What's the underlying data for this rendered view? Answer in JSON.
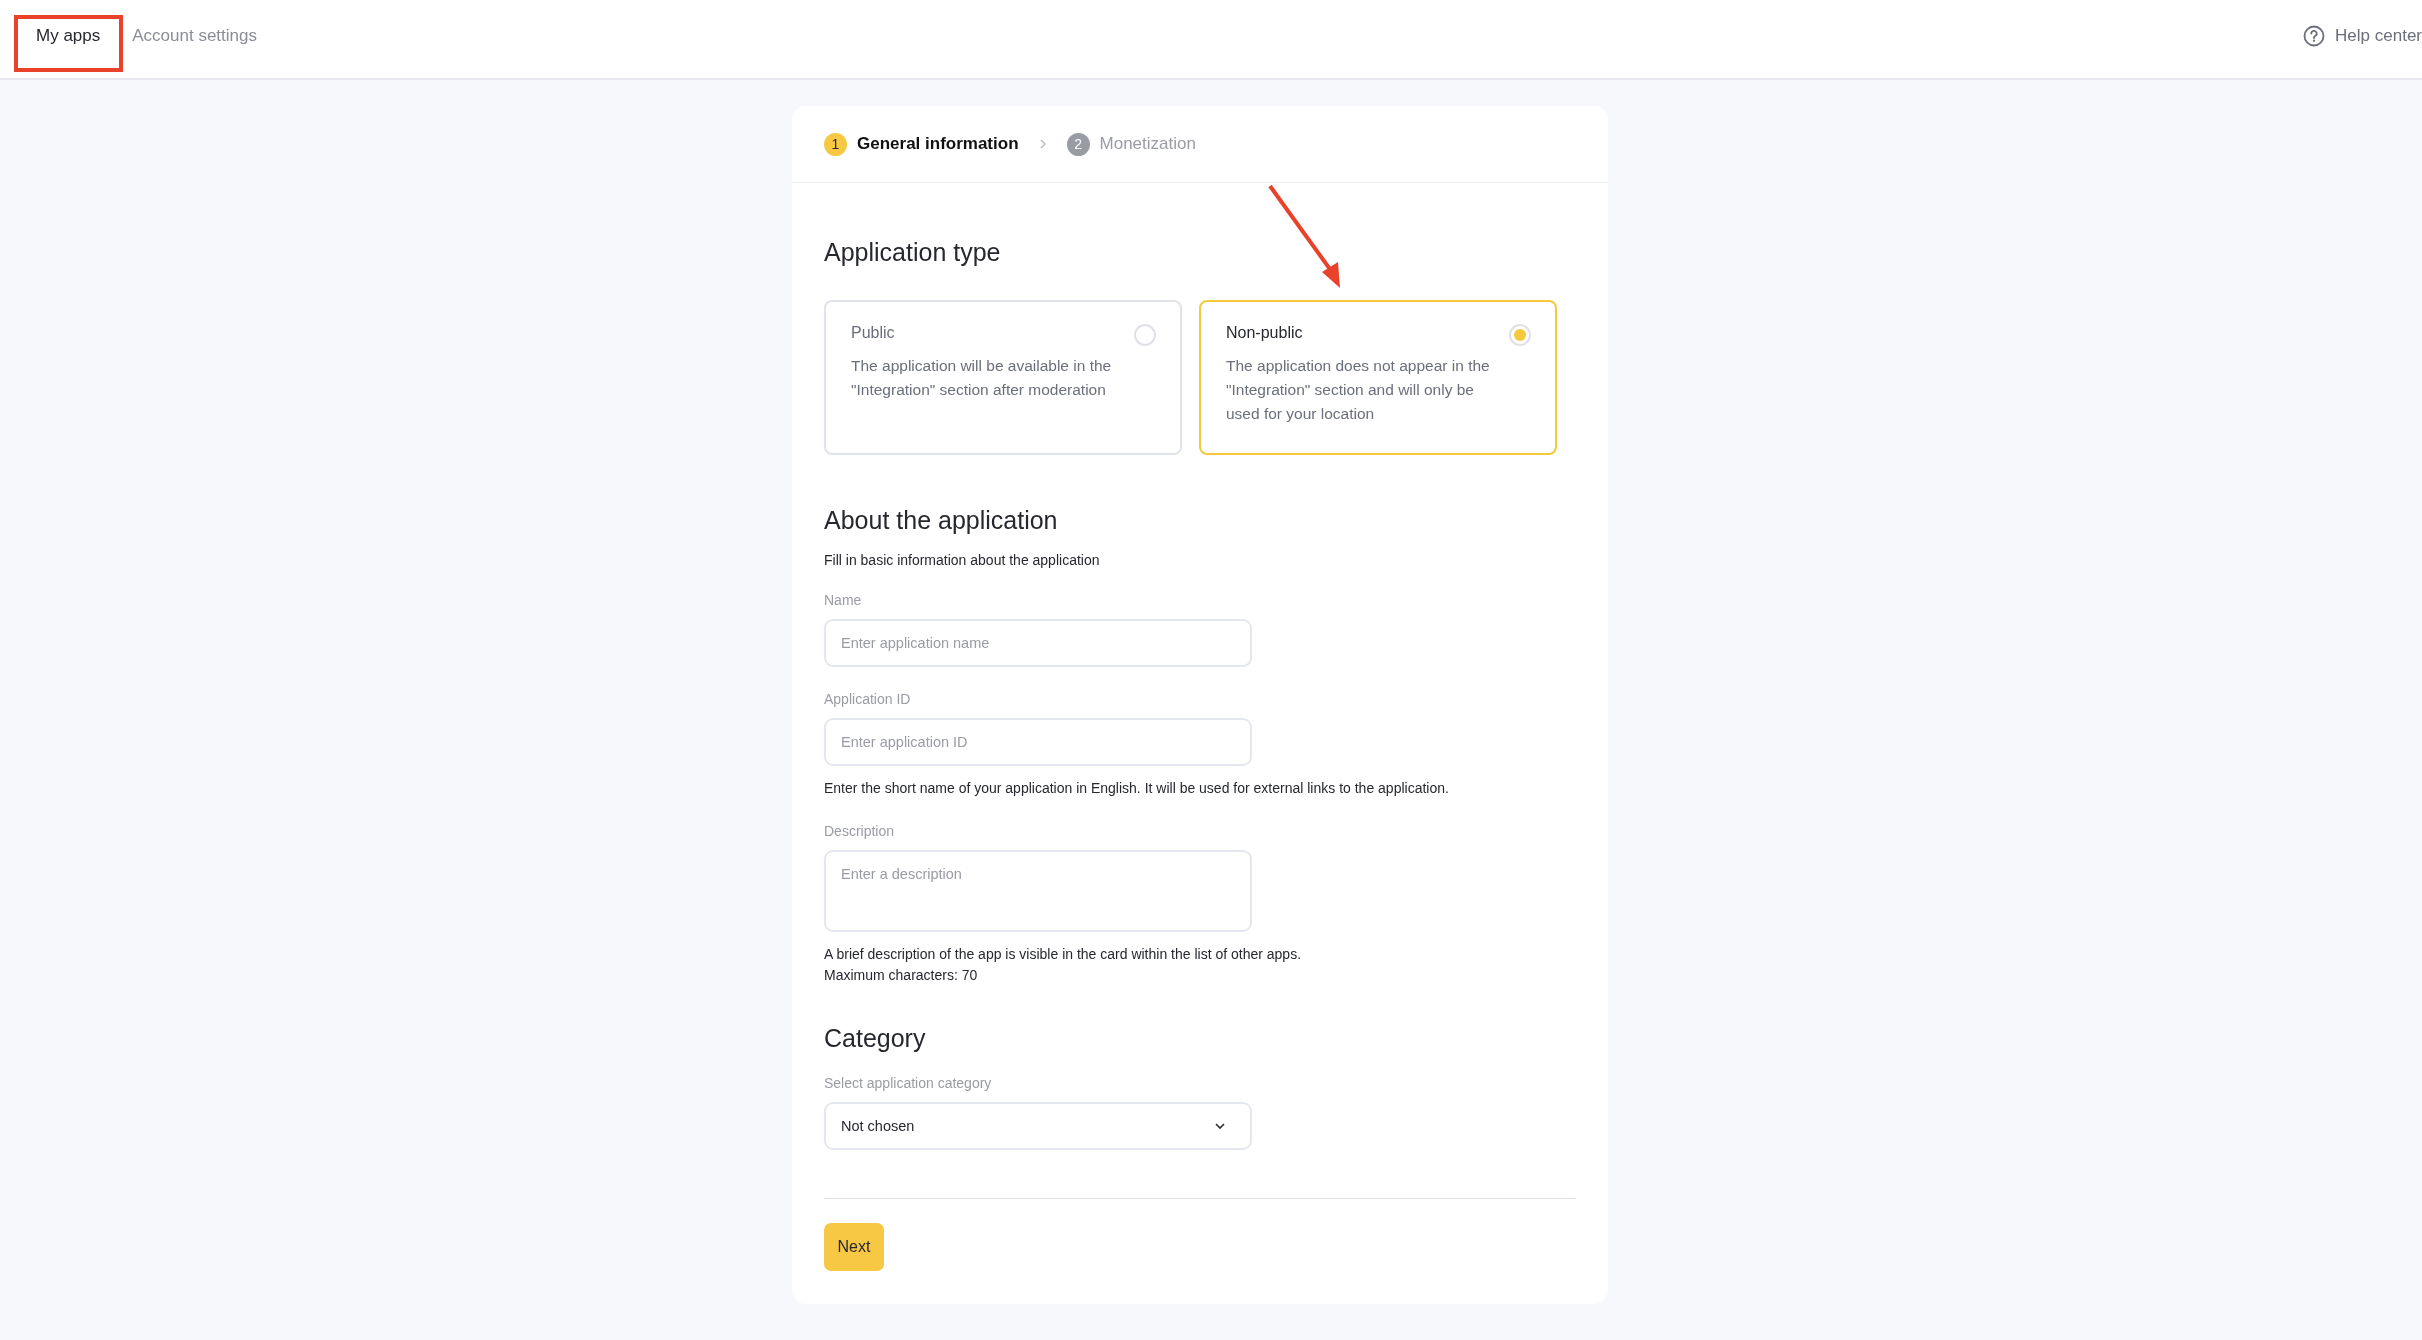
{
  "nav": {
    "tabs": [
      {
        "label": "My apps",
        "selected": true
      },
      {
        "label": "Account settings",
        "selected": false
      }
    ],
    "help": "Help center"
  },
  "stepper": [
    {
      "number": "1",
      "label": "General information",
      "active": true
    },
    {
      "number": "2",
      "label": "Monetization",
      "active": false
    }
  ],
  "application_type": {
    "title": "Application type",
    "options": [
      {
        "title": "Public",
        "description": "The application will be available in the \"Integration\" section after moderation",
        "selected": false
      },
      {
        "title": "Non-public",
        "description": "The application does not appear in the \"Integration\" section and will only be used for your location",
        "selected": true
      }
    ]
  },
  "about": {
    "title": "About the application",
    "subtitle": "Fill in basic information about the application",
    "fields": [
      {
        "kind": "input",
        "label": "Name",
        "placeholder": "Enter application name"
      },
      {
        "kind": "input",
        "label": "Application ID",
        "placeholder": "Enter application ID",
        "hints": [
          "Enter the short name of your application in English. It will be used for external links to the application."
        ]
      },
      {
        "kind": "textarea",
        "label": "Description",
        "placeholder": "Enter a description",
        "hints": [
          "A brief description of the app is visible in the card within the list of other apps.",
          "Maximum characters: 70"
        ]
      }
    ]
  },
  "category": {
    "title": "Category",
    "label": "Select application category",
    "value": "Not chosen"
  },
  "next_button": "Next"
}
